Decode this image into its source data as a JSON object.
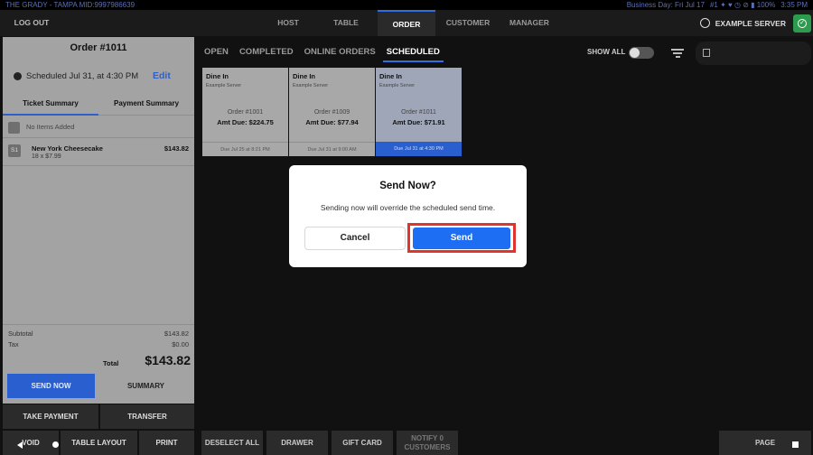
{
  "status_bar": {
    "location": "THE GRADY - TAMPA   MID:9997986639",
    "business_day": "Business Day: Fri Jul 17",
    "indicators": "#1 ✦ ♥ ◷ ⊘ ▮ 100%",
    "time": "3:35 PM"
  },
  "top_nav": {
    "logout": "LOG OUT",
    "tabs": [
      "HOST",
      "TABLE",
      "ORDER",
      "CUSTOMER",
      "MANAGER"
    ],
    "active_tab": "ORDER",
    "server_name": "EXAMPLE SERVER",
    "accent_color": "#2f6fe0"
  },
  "ticket": {
    "title": "Order #1011",
    "scheduled_text": "Scheduled Jul 31, at 4:30 PM",
    "edit_label": "Edit",
    "tabs": [
      "Ticket Summary",
      "Payment Summary"
    ],
    "no_items_text": "No Items Added",
    "items": [
      {
        "seat": "S1",
        "name": "New York Cheesecake",
        "qty_line": "18 x $7.99",
        "price": "$143.82"
      }
    ],
    "subtotal_label": "Subtotal",
    "subtotal_value": "$143.82",
    "tax_label": "Tax",
    "tax_value": "$0.00",
    "total_label": "Total",
    "total_value": "$143.82",
    "send_now_label": "SEND NOW",
    "summary_label": "SUMMARY"
  },
  "left_actions": {
    "take_payment": "TAKE PAYMENT",
    "transfer": "TRANSFER",
    "void": "VOID",
    "table_layout": "TABLE LAYOUT",
    "print": "PRINT"
  },
  "order_tabs": {
    "tabs": [
      "OPEN",
      "COMPLETED",
      "ONLINE ORDERS",
      "SCHEDULED"
    ],
    "active": "SCHEDULED",
    "show_all_label": "SHOW ALL"
  },
  "orders": [
    {
      "type": "Dine In",
      "server": "Example Server",
      "order": "Order #1001",
      "amount": "Amt Due: $224.75",
      "due": "Due Jul 25 at 8:21 PM",
      "selected": false
    },
    {
      "type": "Dine In",
      "server": "Example Server",
      "order": "Order #1009",
      "amount": "Amt Due: $77.94",
      "due": "Due Jul 31 at 9:00 AM",
      "selected": false
    },
    {
      "type": "Dine In",
      "server": "Example Server",
      "order": "Order #1011",
      "amount": "Amt Due: $71.91",
      "due": "Due Jul 31 at 4:30 PM",
      "selected": true
    }
  ],
  "bottom_actions": {
    "deselect_all": "DESELECT ALL",
    "drawer": "DRAWER",
    "gift_card": "GIFT CARD",
    "notify_line1": "NOTIFY 0",
    "notify_line2": "CUSTOMERS",
    "page": "PAGE"
  },
  "dialog": {
    "title": "Send Now?",
    "message": "Sending now will override the scheduled send time.",
    "cancel_label": "Cancel",
    "send_label": "Send",
    "highlight_color": "#e0342f",
    "send_color": "#1e6ef3"
  }
}
